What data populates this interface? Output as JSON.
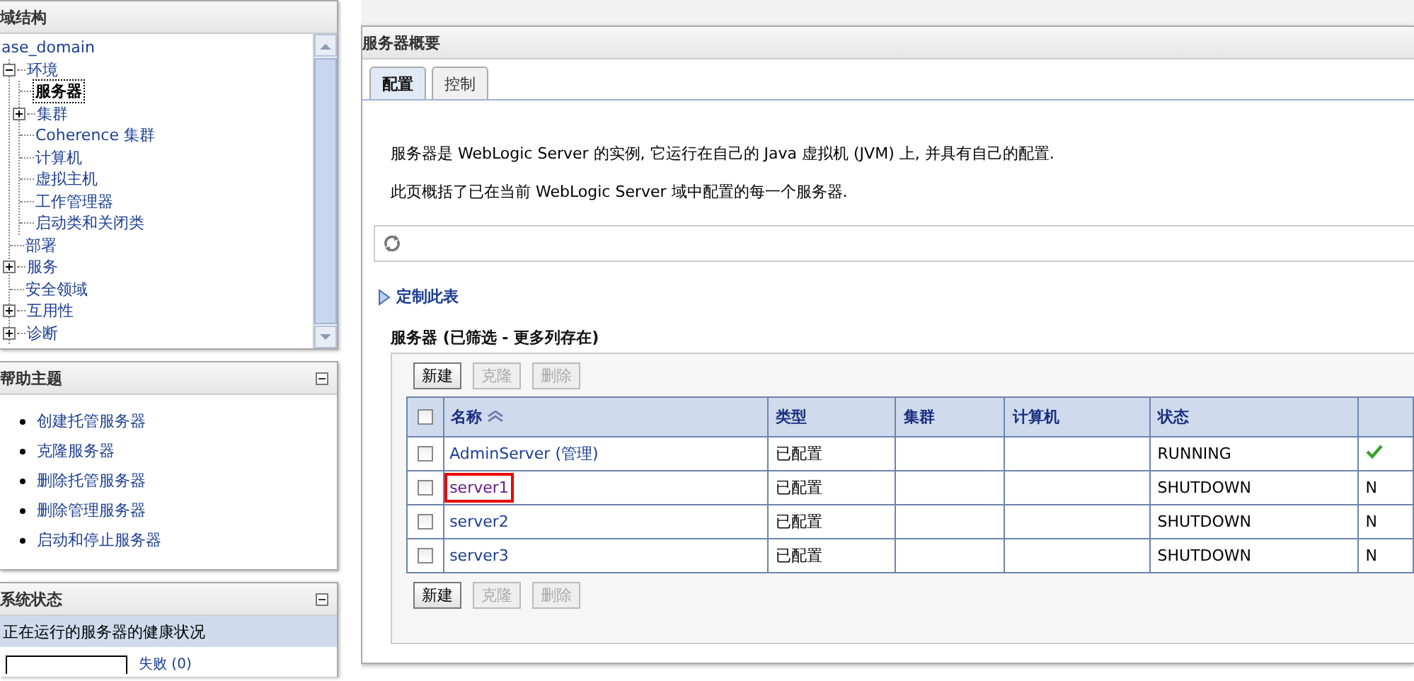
{
  "domain_structure": {
    "title": "域结构",
    "tree": [
      {
        "label": "ase_domain",
        "selected": false,
        "children": [
          {
            "label": "环境",
            "expanded": true,
            "selected": false,
            "children": [
              {
                "label": "服务器",
                "selected": true
              },
              {
                "label": "集群",
                "expanded": false,
                "selected": false
              },
              {
                "label": "Coherence 集群",
                "selected": false
              },
              {
                "label": "计算机",
                "selected": false
              },
              {
                "label": "虚拟主机",
                "selected": false
              },
              {
                "label": "工作管理器",
                "selected": false
              },
              {
                "label": "启动类和关闭类",
                "selected": false
              }
            ]
          },
          {
            "label": "部署",
            "selected": false
          },
          {
            "label": "服务",
            "expanded": false,
            "selected": false
          },
          {
            "label": "安全领域",
            "selected": false
          },
          {
            "label": "互用性",
            "expanded": false,
            "selected": false
          },
          {
            "label": "诊断",
            "expanded": false,
            "selected": false
          }
        ]
      }
    ]
  },
  "help_topics": {
    "title": "帮助主题",
    "links": [
      "创建托管服务器",
      "克隆服务器",
      "删除托管服务器",
      "删除管理服务器",
      "启动和停止服务器"
    ]
  },
  "system_status": {
    "title": "系统状态",
    "subtitle": "正在运行的服务器的健康状况",
    "bars": [
      {
        "label": "失败 (0)"
      }
    ]
  },
  "summary": {
    "title": "服务器概要",
    "tabs": [
      {
        "label": "配置",
        "selected": true
      },
      {
        "label": "控制",
        "selected": false
      }
    ],
    "paragraphs": [
      "服务器是 WebLogic Server 的实例, 它运行在自己的 Java 虚拟机 (JVM) 上, 并具有自己的配置.",
      "此页概括了已在当前 WebLogic Server 域中配置的每一个服务器."
    ],
    "customize_link": "定制此表",
    "table_title": "服务器 (已筛选 - 更多列存在)",
    "buttons": [
      {
        "label": "新建",
        "disabled": false
      },
      {
        "label": "克隆",
        "disabled": true
      },
      {
        "label": "删除",
        "disabled": true
      }
    ],
    "bottom_buttons": [
      {
        "label": "新建",
        "disabled": false
      },
      {
        "label": "克隆",
        "disabled": true
      },
      {
        "label": "删除",
        "disabled": true
      }
    ],
    "select_all": {
      "checked": false
    },
    "columns": [
      {
        "label": "名称",
        "sorted": true
      },
      {
        "label": "类型",
        "sorted": false
      },
      {
        "label": "集群",
        "sorted": false
      },
      {
        "label": "计算机",
        "sorted": false
      },
      {
        "label": "状态",
        "sorted": false
      }
    ],
    "rows": [
      {
        "checked": false,
        "name": "AdminServer (管理)",
        "visited": false,
        "highlighted": false,
        "type": "已配置",
        "state": "RUNNING",
        "health_ok": true
      },
      {
        "checked": false,
        "name": "server1",
        "visited": true,
        "highlighted": true,
        "type": "已配置",
        "state": "SHUTDOWN",
        "health_ok": false,
        "column_7": "N"
      },
      {
        "checked": false,
        "name": "server2",
        "visited": false,
        "highlighted": false,
        "type": "已配置",
        "state": "SHUTDOWN",
        "health_ok": false,
        "column_7": "N"
      },
      {
        "checked": false,
        "name": "server3",
        "visited": false,
        "highlighted": false,
        "type": "已配置",
        "state": "SHUTDOWN",
        "health_ok": false,
        "column_7": "N"
      }
    ]
  }
}
